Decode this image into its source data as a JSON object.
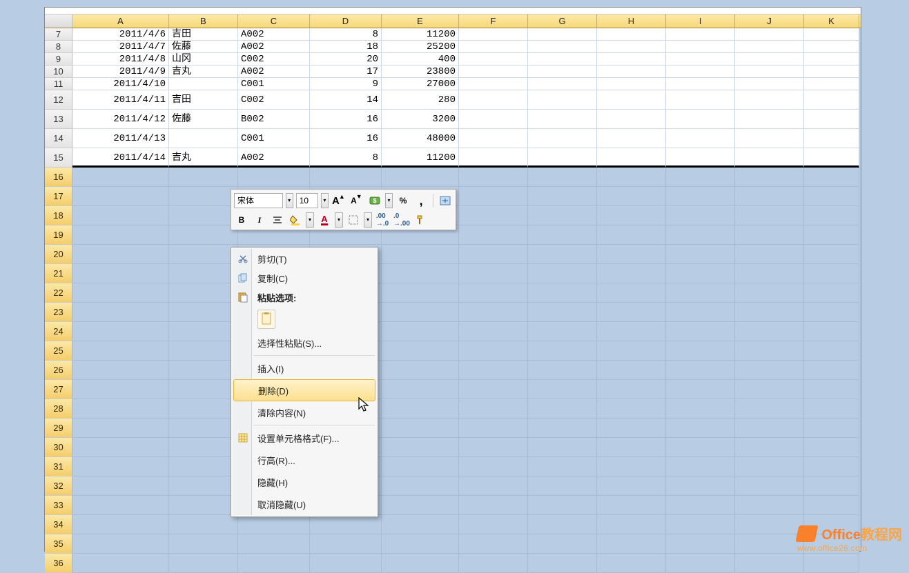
{
  "columns": [
    "A",
    "B",
    "C",
    "D",
    "E",
    "F",
    "G",
    "H",
    "I",
    "J",
    "K"
  ],
  "rows": [
    {
      "n": 7,
      "A": "2011/4/6",
      "B": "吉田",
      "C": "A002",
      "D": 8,
      "E": 11200
    },
    {
      "n": 8,
      "A": "2011/4/7",
      "B": "佐藤",
      "C": "A002",
      "D": 18,
      "E": 25200
    },
    {
      "n": 9,
      "A": "2011/4/8",
      "B": "山冈",
      "C": "C002",
      "D": 20,
      "E": 400
    },
    {
      "n": 10,
      "A": "2011/4/9",
      "B": "吉丸",
      "C": "A002",
      "D": 17,
      "E": 23800
    },
    {
      "n": 11,
      "A": "2011/4/10",
      "B": "",
      "C": "C001",
      "D": 9,
      "E": 27000
    },
    {
      "n": 12,
      "A": "2011/4/11",
      "B": "吉田",
      "C": "C002",
      "D": 14,
      "E": 280
    },
    {
      "n": 13,
      "A": "2011/4/12",
      "B": "佐藤",
      "C": "B002",
      "D": 16,
      "E": 3200
    },
    {
      "n": 14,
      "A": "2011/4/13",
      "B": "",
      "C": "C001",
      "D": 16,
      "E": 48000
    },
    {
      "n": 15,
      "A": "2011/4/14",
      "B": "吉丸",
      "C": "A002",
      "D": 8,
      "E": 11200
    }
  ],
  "empty_row_start": 16,
  "empty_row_end": 36,
  "mini_toolbar": {
    "font_name": "宋体",
    "font_size": "10",
    "btn_bold": "B",
    "btn_italic": "I",
    "percent": "%",
    "comma": ","
  },
  "context_menu": {
    "cut": "剪切(T)",
    "copy": "复制(C)",
    "paste_options_label": "粘贴选项:",
    "paste_special": "选择性粘贴(S)...",
    "insert": "插入(I)",
    "delete": "删除(D)",
    "clear": "清除内容(N)",
    "format_cells": "设置单元格格式(F)...",
    "row_height": "行高(R)...",
    "hide": "隐藏(H)",
    "unhide": "取消隐藏(U)"
  },
  "watermark": {
    "brand_en": "Office",
    "brand_zh": "教程网",
    "url": "www.office26.com"
  }
}
